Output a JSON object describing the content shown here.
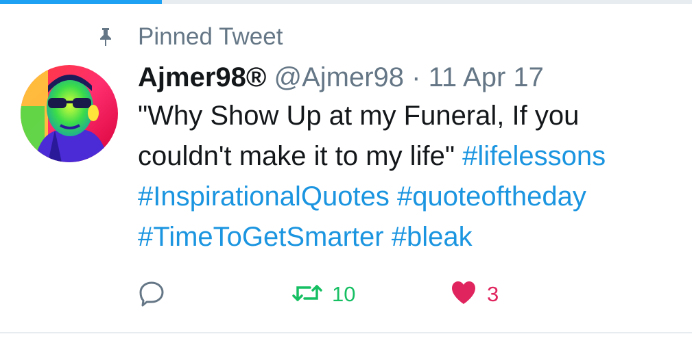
{
  "tabs": {
    "active_indicator_color": "#1da1f2"
  },
  "pinned": {
    "icon": "pin-icon",
    "label": "Pinned Tweet"
  },
  "tweet": {
    "avatar_icon": "avatar",
    "display_name": "Ajmer98®",
    "handle": "@Ajmer98",
    "separator": "·",
    "date": "11 Apr 17",
    "text_line1": "\"Why Show Up at my Funeral, If you",
    "text_line2": "couldn't make it to my life\" ",
    "hashtags": {
      "lifelessons": "#lifelessons",
      "inspirational": "#InspirationalQuotes",
      "quoteoftheday": "#quoteoftheday",
      "timetogetsmarter": "#TimeToGetSmarter",
      "bleak": "#bleak"
    }
  },
  "actions": {
    "reply": {
      "icon": "reply-icon",
      "count": ""
    },
    "retweet": {
      "icon": "retweet-icon",
      "count": "10"
    },
    "like": {
      "icon": "heart-icon",
      "count": "3"
    }
  },
  "colors": {
    "hashtag": "#1b95e0",
    "secondary_text": "#657786",
    "retweet_green": "#17bf63",
    "like_red": "#e0245e"
  }
}
